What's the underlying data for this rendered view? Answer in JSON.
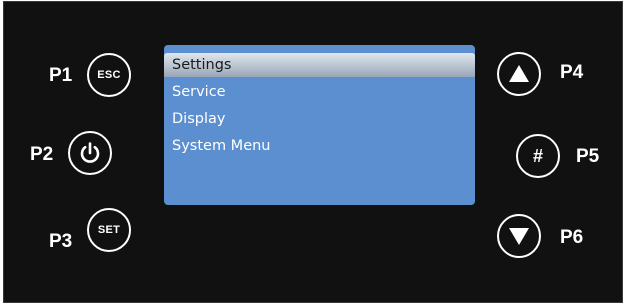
{
  "buttons": {
    "p1": {
      "label": "P1",
      "key": "ESC"
    },
    "p2": {
      "label": "P2",
      "icon": "power-icon"
    },
    "p3": {
      "label": "P3",
      "key": "SET"
    },
    "p4": {
      "label": "P4",
      "icon": "arrow-up-icon"
    },
    "p5": {
      "label": "P5",
      "key": "#"
    },
    "p6": {
      "label": "P6",
      "icon": "arrow-down-icon"
    }
  },
  "screen": {
    "background": "#5b8fd0",
    "menu": [
      {
        "label": "Settings",
        "selected": true
      },
      {
        "label": "Service",
        "selected": false
      },
      {
        "label": "Display",
        "selected": false
      },
      {
        "label": "System Menu",
        "selected": false
      }
    ]
  }
}
